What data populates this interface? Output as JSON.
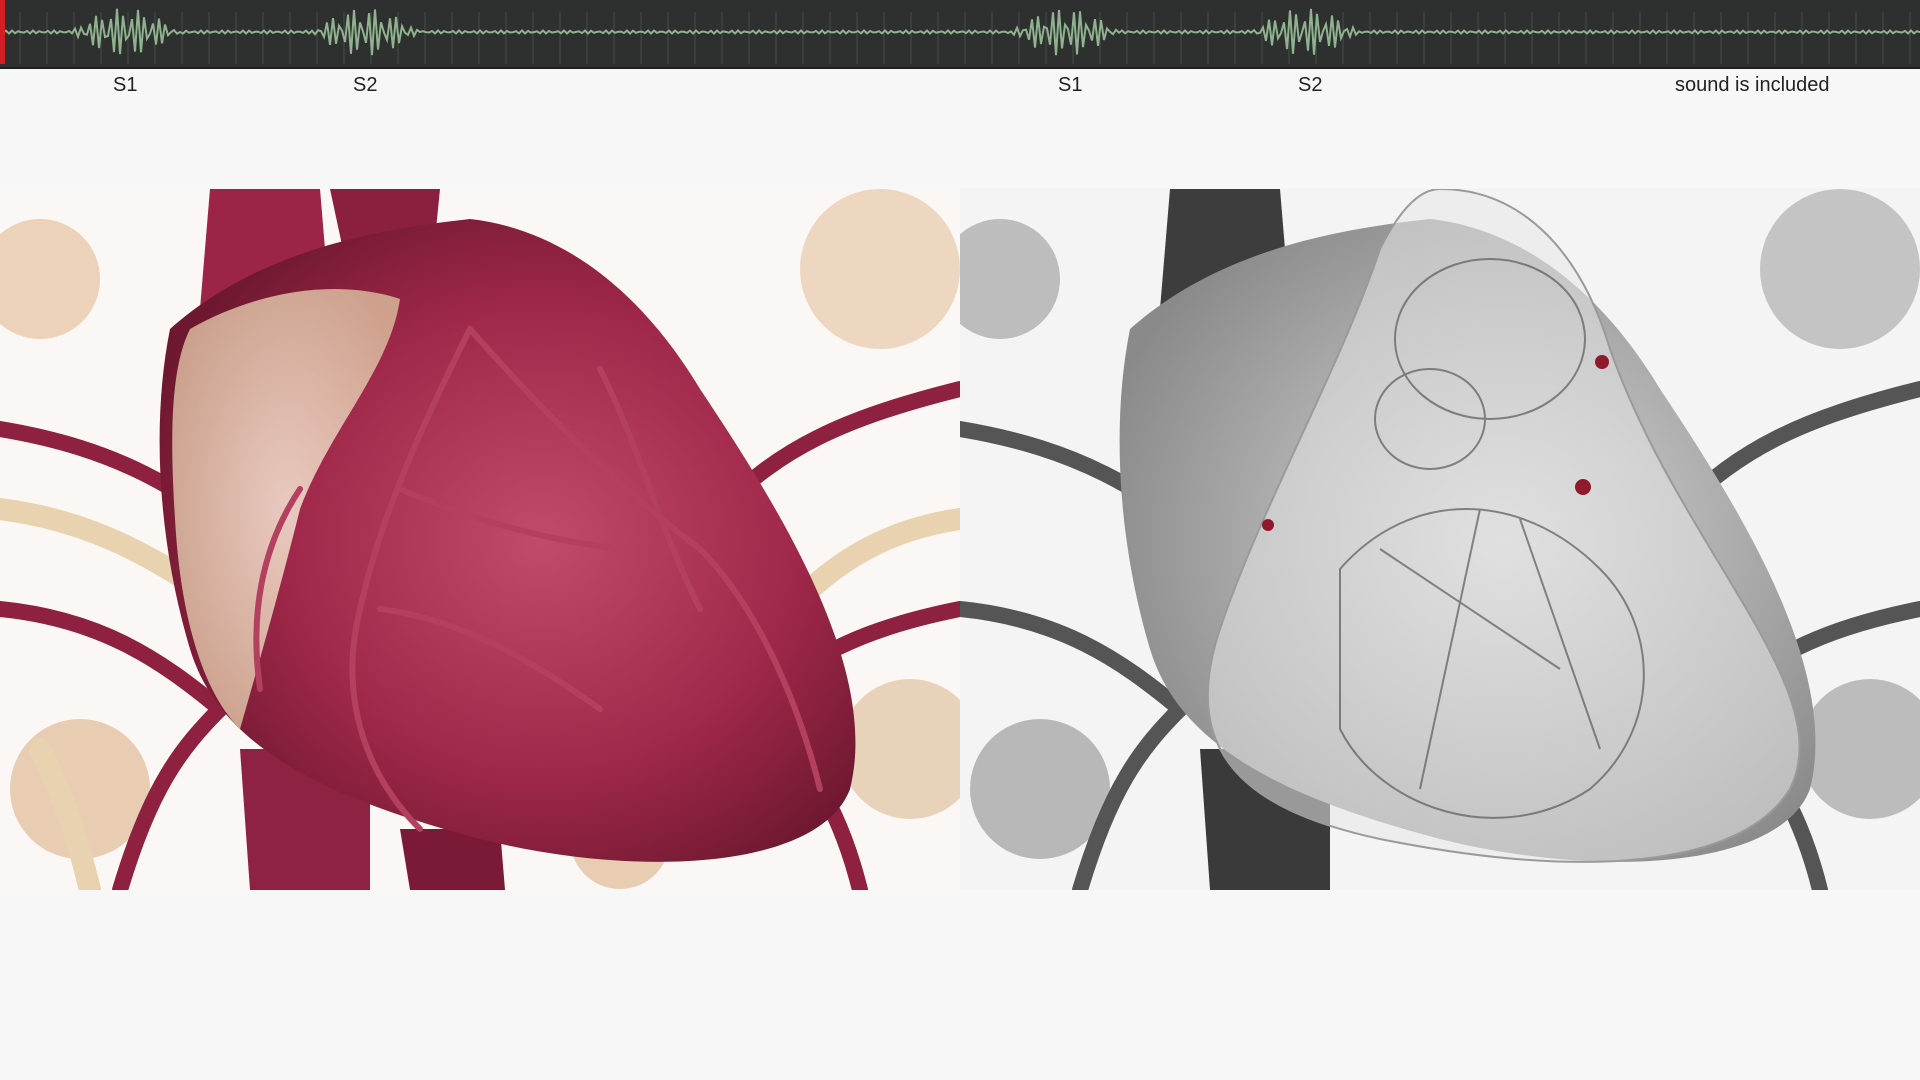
{
  "timeline": {
    "playhead_color": "#d21f26",
    "waveform_color": "#8fb38f",
    "background": "#2e302f",
    "tick_count": 70
  },
  "labels": {
    "s1_first": "S1",
    "s2_first": "S2",
    "s1_second": "S1",
    "s2_second": "S2",
    "sound_note": "sound is included"
  },
  "panels": {
    "left": {
      "content": "heart-color-render"
    },
    "right": {
      "content": "heart-xray-render"
    }
  }
}
